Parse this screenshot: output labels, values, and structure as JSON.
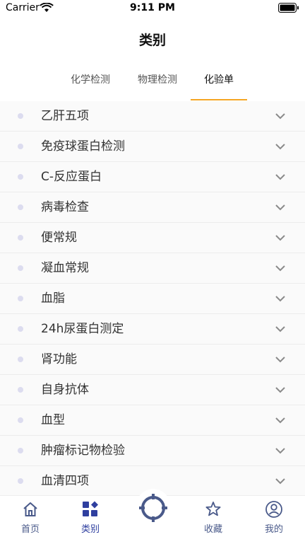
{
  "status_bar": {
    "carrier": "Carrier",
    "time": "9:11 PM"
  },
  "header": {
    "title": "类别"
  },
  "tabs": [
    {
      "label": "化学检测"
    },
    {
      "label": "物理检测"
    },
    {
      "label": "化验单"
    }
  ],
  "list": {
    "items": [
      {
        "label": "乙肝五项"
      },
      {
        "label": "免疫球蛋白检测"
      },
      {
        "label": "C-反应蛋白"
      },
      {
        "label": "病毒检查"
      },
      {
        "label": "便常规"
      },
      {
        "label": "凝血常规"
      },
      {
        "label": "血脂"
      },
      {
        "label": "24h尿蛋白测定"
      },
      {
        "label": "肾功能"
      },
      {
        "label": "自身抗体"
      },
      {
        "label": "血型"
      },
      {
        "label": "肿瘤标记物检验"
      },
      {
        "label": "血清四项"
      }
    ]
  },
  "tabbar": {
    "home_label": "首页",
    "category_label": "类别",
    "favorites_label": "收藏",
    "mine_label": "我的"
  },
  "colors": {
    "accent": "#f5a623",
    "tab_active": "#2f3f9f",
    "dot": "#dcdcef"
  }
}
